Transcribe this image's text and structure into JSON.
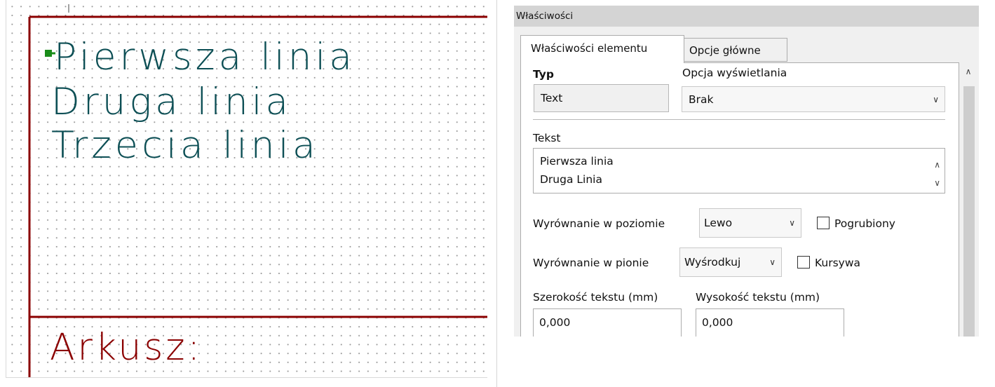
{
  "schematic": {
    "text_lines": [
      "Pierwsza linia",
      "Druga linia",
      "Trzecia linia"
    ],
    "sheet_label": "Arkusz:",
    "colors": {
      "text": "#0d4f55",
      "frame": "#8b0000",
      "anchor": "#1a8c1a"
    }
  },
  "properties": {
    "window_title": "Właściwości",
    "tabs": [
      {
        "label": "Właściwości elementu",
        "active": true
      },
      {
        "label": "Opcje główne",
        "active": false
      }
    ],
    "type": {
      "label": "Typ",
      "value": "Text"
    },
    "display_option": {
      "label": "Opcja wyświetlania",
      "value": "Brak"
    },
    "text": {
      "label": "Tekst",
      "lines": [
        "Pierwsza linia",
        "Druga Linia"
      ]
    },
    "h_align": {
      "label": "Wyrównanie w poziomie",
      "value": "Lewo"
    },
    "bold": {
      "label": "Pogrubiony",
      "checked": false
    },
    "v_align": {
      "label": "Wyrównanie w pionie",
      "value": "Wyśrodkuj"
    },
    "italic": {
      "label": "Kursywa",
      "checked": false
    },
    "width": {
      "label": "Szerokość tekstu (mm)",
      "value": "0,000"
    },
    "height": {
      "label": "Wysokość tekstu (mm)",
      "value": "0,000"
    }
  }
}
